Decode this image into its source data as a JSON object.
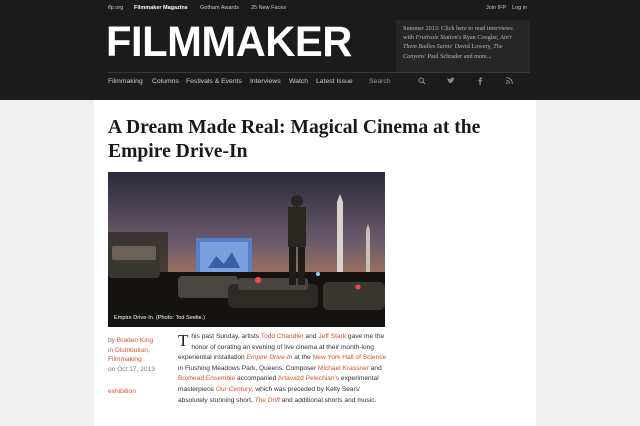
{
  "utility": {
    "links": [
      {
        "label": "ifp.org",
        "active": false
      },
      {
        "label": "Filmmaker Magazine",
        "active": true
      },
      {
        "label": "Gotham Awards",
        "active": false
      },
      {
        "label": "25 New Faces",
        "active": false
      }
    ],
    "join": "Join IFP",
    "login": "Log in"
  },
  "logo": "FILMMAKER",
  "promo": {
    "lead": "Summer 2013: Click here to read interviews with ",
    "film1": "Fruitvale Station's",
    "p1": " Ryan Coogler, ",
    "film2": "Ain't Them Bodies Saints'",
    "p2": " David Lowery, ",
    "film3": "The Canyons'",
    "p3": " Paul Schrader and more..."
  },
  "nav": {
    "items": [
      "Filmmaking",
      "Columns",
      "Festivals & Events",
      "Interviews",
      "Watch",
      "Latest Issue"
    ],
    "search_placeholder": "Search"
  },
  "article": {
    "title": "A Dream Made Real: Magical Cinema at the Empire Drive-In",
    "caption": "Empire Drive-In. (Photo: Tod Seelie.)",
    "meta": {
      "by": "by ",
      "author": "Braden King",
      "in": "in ",
      "cat1": "Distribution",
      "cat2": "Filmmaking",
      "date_prefix": "on ",
      "date": "Oct 17, 2013",
      "tag": "exhibition"
    },
    "body": {
      "dropcap": "T",
      "t1": "his past Sunday, artists ",
      "l1": "Todd Chandler",
      "t2": " and ",
      "l2": "Jeff Stark",
      "t3": " gave me the honor of curating an evening of live cinema at their month-long experiential installation ",
      "l3": "Empire Drive-In",
      "t4": " at the ",
      "l4": "New York Hall of Science",
      "t5": " in Flushing Meadows Park, Queens. Composer ",
      "l5": "Michael Krassner",
      "t6": " and ",
      "l6": "Boxhead Ensemble",
      "t7": " accompanied ",
      "l7": "Artavazd Pelechian's",
      "t8": " experimental masterpiece ",
      "l8": "Our Century",
      "t9": ", which was preceded by Kelly Sears' absolutely stunning short, ",
      "l9": "The Drift",
      "t10": " and additional shorts and music."
    }
  },
  "colors": {
    "bar": "#1b1b1b",
    "accent": "#d9532c",
    "page": "#ffffff"
  },
  "icons": [
    "search-icon",
    "twitter-icon",
    "facebook-icon",
    "rss-icon"
  ]
}
